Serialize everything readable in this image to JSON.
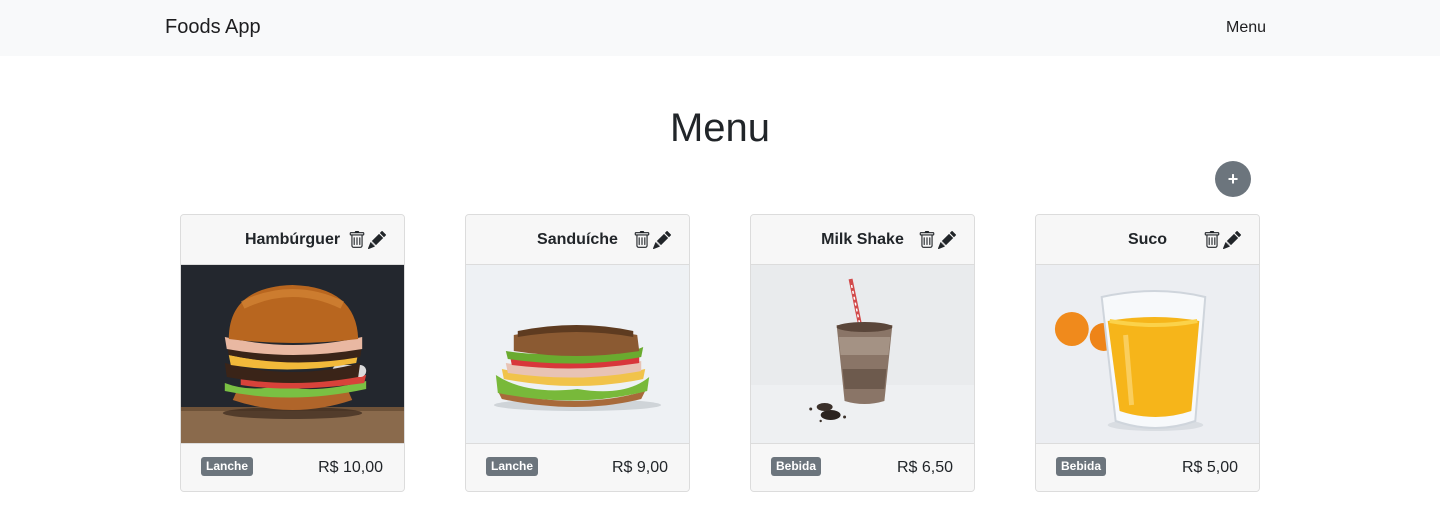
{
  "navbar": {
    "brand": "Foods App",
    "menu_link": "Menu"
  },
  "page": {
    "title": "Menu",
    "add_button": "+"
  },
  "products": [
    {
      "name": "Hambúrguer",
      "category": "Lanche",
      "price": "R$ 10,00"
    },
    {
      "name": "Sanduíche",
      "category": "Lanche",
      "price": "R$ 9,00"
    },
    {
      "name": "Milk Shake",
      "category": "Bebida",
      "price": "R$ 6,50"
    },
    {
      "name": "Suco",
      "category": "Bebida",
      "price": "R$ 5,00"
    }
  ],
  "colors": {
    "navbar_bg": "#f8f9fa",
    "badge_bg": "#6c757d",
    "add_button_bg": "#6c757d",
    "card_bg": "#f7f7f7"
  },
  "icons": {
    "delete": "trash-icon",
    "edit": "pencil-icon",
    "add": "plus-icon"
  }
}
